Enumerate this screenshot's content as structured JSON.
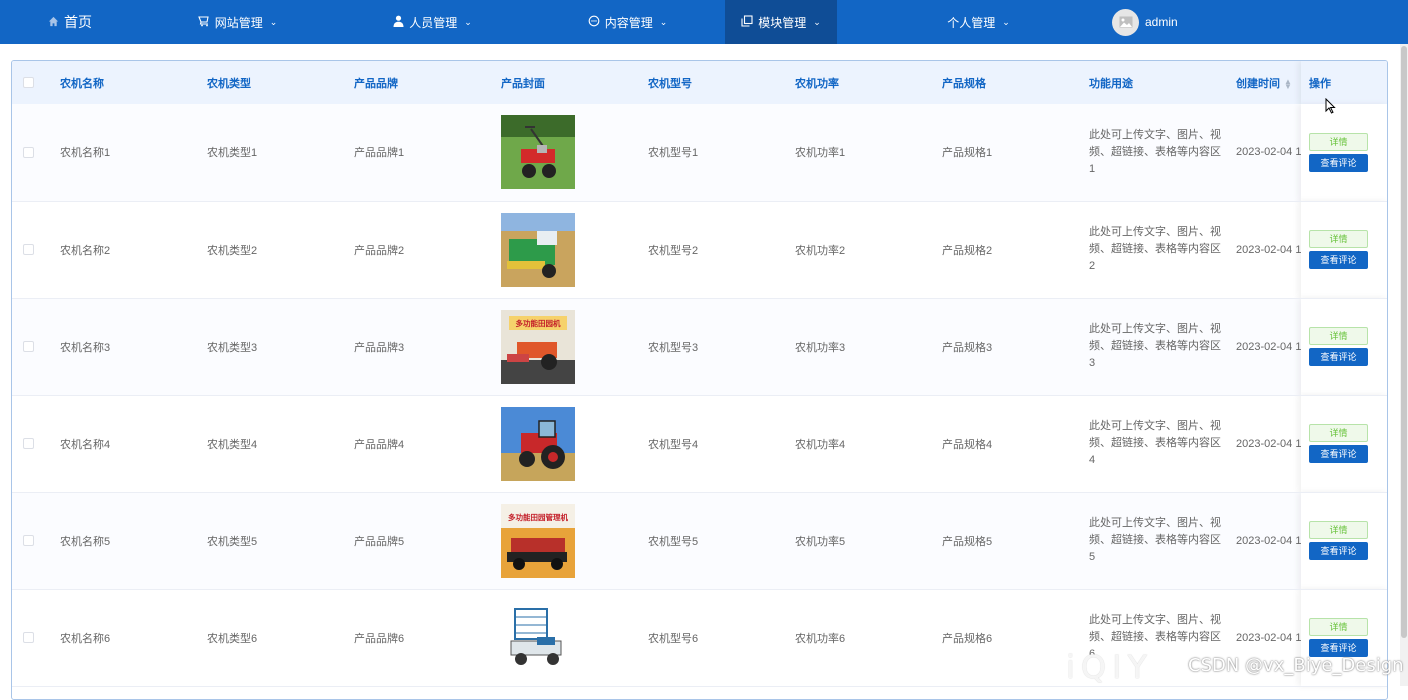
{
  "nav": {
    "home": "首页",
    "site": "网站管理",
    "staff": "人员管理",
    "content": "内容管理",
    "module": "模块管理",
    "personal": "个人管理",
    "user": "admin"
  },
  "table": {
    "headers": {
      "name": "农机名称",
      "type": "农机类型",
      "brand": "产品品牌",
      "cover": "产品封面",
      "model": "农机型号",
      "power": "农机功率",
      "spec": "产品规格",
      "usage": "功能用途",
      "created": "创建时间",
      "ops": "操作"
    },
    "rows": [
      {
        "name": "农机名称1",
        "type": "农机类型1",
        "brand": "产品品牌1",
        "model": "农机型号1",
        "power": "农机功率1",
        "spec": "产品规格1",
        "usage": "此处可上传文字、图片、视频、超链接、表格等内容区1",
        "created": "2023-02-04 1",
        "detail": "详情",
        "review": "查看评论"
      },
      {
        "name": "农机名称2",
        "type": "农机类型2",
        "brand": "产品品牌2",
        "model": "农机型号2",
        "power": "农机功率2",
        "spec": "产品规格2",
        "usage": "此处可上传文字、图片、视频、超链接、表格等内容区2",
        "created": "2023-02-04 1",
        "detail": "详情",
        "review": "查看评论"
      },
      {
        "name": "农机名称3",
        "type": "农机类型3",
        "brand": "产品品牌3",
        "model": "农机型号3",
        "power": "农机功率3",
        "spec": "产品规格3",
        "usage": "此处可上传文字、图片、视频、超链接、表格等内容区3",
        "created": "2023-02-04 1",
        "detail": "详情",
        "review": "查看评论",
        "cover_caption": "多功能田园机"
      },
      {
        "name": "农机名称4",
        "type": "农机类型4",
        "brand": "产品品牌4",
        "model": "农机型号4",
        "power": "农机功率4",
        "spec": "产品规格4",
        "usage": "此处可上传文字、图片、视频、超链接、表格等内容区4",
        "created": "2023-02-04 1",
        "detail": "详情",
        "review": "查看评论"
      },
      {
        "name": "农机名称5",
        "type": "农机类型5",
        "brand": "产品品牌5",
        "model": "农机型号5",
        "power": "农机功率5",
        "spec": "产品规格5",
        "usage": "此处可上传文字、图片、视频、超链接、表格等内容区5",
        "created": "2023-02-04 1",
        "detail": "详情",
        "review": "查看评论",
        "cover_caption": "多功能田园管理机"
      },
      {
        "name": "农机名称6",
        "type": "农机类型6",
        "brand": "产品品牌6",
        "model": "农机型号6",
        "power": "农机功率6",
        "spec": "产品规格6",
        "usage": "此处可上传文字、图片、视频、超链接、表格等内容区6",
        "created": "2023-02-04 1",
        "detail": "详情",
        "review": "查看评论"
      }
    ]
  },
  "watermark": "CSDN @vx_Biye_Design",
  "colors": {
    "nav_bg": "#1266c5",
    "nav_active": "#0f4d96",
    "header_bg": "#ecf3fe",
    "detail_green": "#67c23a",
    "review_blue": "#1266c5"
  }
}
